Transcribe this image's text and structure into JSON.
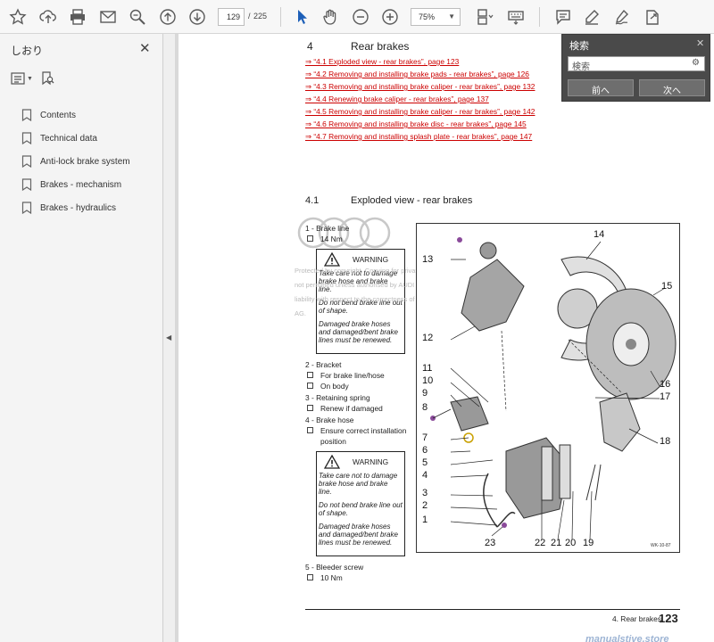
{
  "toolbar": {
    "page_current": "129",
    "page_separator": "/",
    "page_total": "225",
    "zoom": "75%",
    "icons": [
      "bookmark-star-icon",
      "upload-icon",
      "print-icon",
      "email-icon",
      "search-zoom-icon",
      "page-up-icon",
      "page-down-icon",
      "select-cursor-icon",
      "hand-icon",
      "zoom-out-icon",
      "zoom-in-icon",
      "page-layout-icon",
      "keyboard-icon",
      "comment-icon",
      "highlight-pen-icon",
      "sign-icon",
      "share-icon"
    ]
  },
  "sidebar": {
    "title": "しおり",
    "close": "✕",
    "bookmarks": [
      {
        "label": "Contents"
      },
      {
        "label": "Technical data"
      },
      {
        "label": "Anti-lock brake system"
      },
      {
        "label": "Brakes - mechanism"
      },
      {
        "label": "Brakes - hydraulics"
      }
    ]
  },
  "document": {
    "section_number": "4",
    "section_title": "Rear brakes",
    "links": [
      "⇒ “4.1 Exploded view - rear brakes”, page 123",
      "⇒ “4.2 Removing and installing brake pads - rear brakes”, page 126",
      "⇒ “4.3 Removing and installing brake caliper - rear brakes”, page 132",
      "⇒ “4.4 Renewing brake caliper - rear brakes”, page 137",
      "⇒ “4.5 Removing and installing brake caliper - rear brakes”, page 142",
      "⇒ “4.6 Removing and installing brake disc - rear brakes”, page 145",
      "⇒ “4.7 Removing and installing splash plate - rear brakes”, page 147"
    ],
    "subsection_number": "4.1",
    "subsection_title": "Exploded view - rear brakes",
    "parts": {
      "p1_title": "1 - Brake line",
      "p1_sub": "14 Nm",
      "warning_label": "WARNING",
      "warning_line1": "Take care not to damage brake hose and brake line.",
      "warning_line2": "Do not bend brake line out of shape.",
      "warning_line3": "Damaged brake hoses and damaged/bent brake lines must be renewed.",
      "p2_title": "2 - Bracket",
      "p2_sub1": "For brake line/hose",
      "p2_sub2": "On body",
      "p3_title": "3 - Retaining spring",
      "p3_sub": "Renew if damaged",
      "p4_title": "4 - Brake hose",
      "p4_sub": "Ensure correct installation position",
      "p5_title": "5 - Bleeder screw",
      "p5_sub": "10 Nm"
    },
    "figure": {
      "labels": [
        "13",
        "14",
        "15",
        "12",
        "16",
        "17",
        "11",
        "10",
        "9",
        "8",
        "7",
        "6",
        "5",
        "4",
        "3",
        "2",
        "1",
        "18",
        "23",
        "22",
        "21",
        "20",
        "19"
      ],
      "code": "WK-10-87"
    },
    "watermark": "Protected by copyright. Copying for private or commercial purposes, in part or in whole, is not permitted unless authorised by AUDI AG. AUDI AG does not guarantee or accept any liability with respect to the correctness of information in this document. Copyright by AUDI AG.",
    "footer_text": "4. Rear brakes",
    "footer_page": "123",
    "site_mark": "manualstive.store"
  },
  "find": {
    "title": "検索",
    "placeholder": "検索",
    "prev": "前へ",
    "next": "次へ"
  }
}
